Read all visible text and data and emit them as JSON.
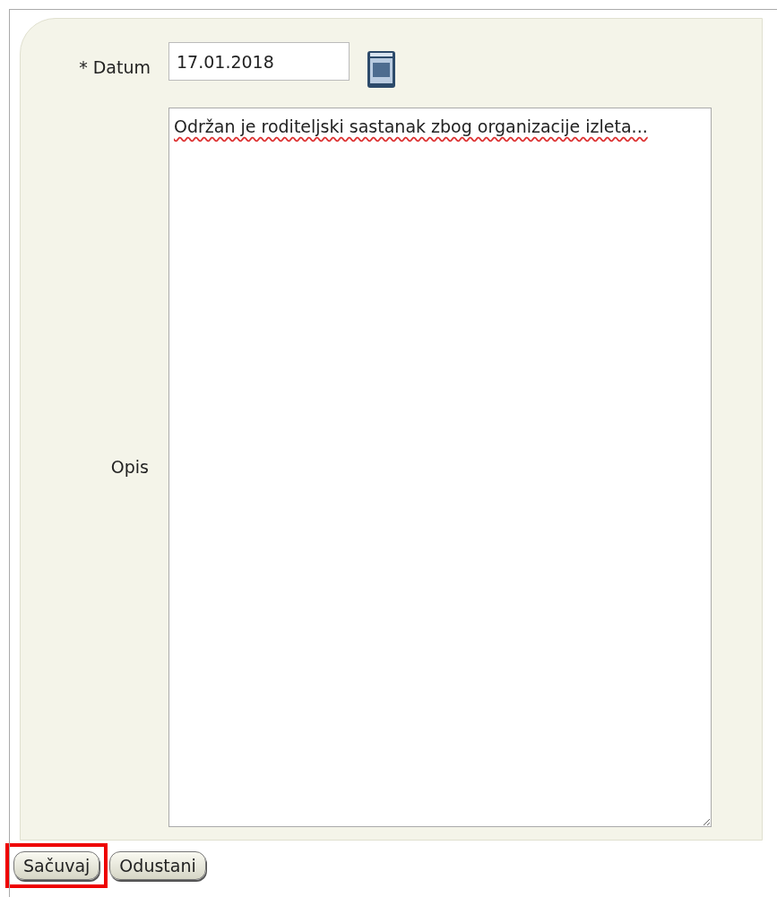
{
  "form": {
    "date": {
      "label": "* Datum",
      "value": "17.01.2018"
    },
    "description": {
      "label": "Opis",
      "value": "Održan je roditeljski sastanak zbog organizacije izleta..."
    }
  },
  "buttons": [
    {
      "label": "Sačuvaj",
      "highlighted": true
    },
    {
      "label": "Odustani",
      "highlighted": false
    }
  ]
}
